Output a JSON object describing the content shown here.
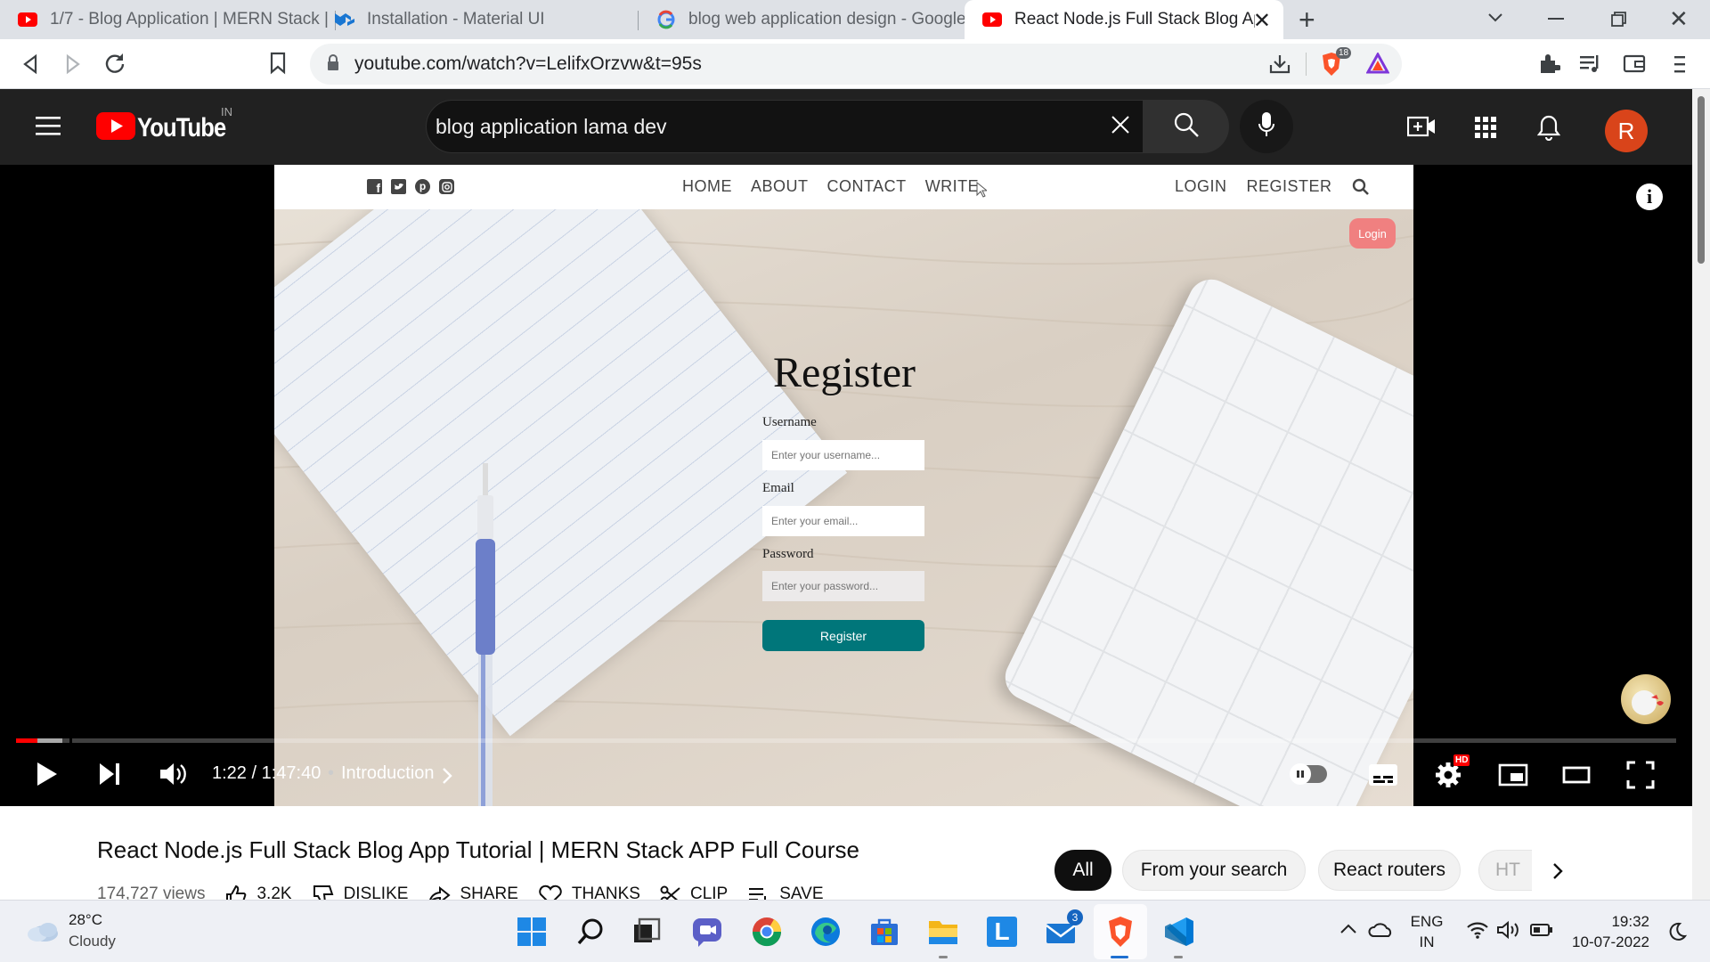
{
  "browser": {
    "tabs": [
      {
        "title": "1/7 - Blog Application | MERN Stack |",
        "favicon": "youtube-icon"
      },
      {
        "title": "Installation - Material UI",
        "favicon": "mui-icon"
      },
      {
        "title": "blog web application design - Google",
        "favicon": "google-icon"
      },
      {
        "title": "React Node.js Full Stack Blog App",
        "favicon": "youtube-icon"
      }
    ],
    "url": "youtube.com/watch?v=LelifxOrzvw&t=95s",
    "brave_badge": "18"
  },
  "youtube": {
    "logo_text": "YouTube",
    "country": "IN",
    "search_value": "blog application lama dev",
    "avatar_letter": "R"
  },
  "video_page": {
    "nav_left": [
      "HOME",
      "ABOUT",
      "CONTACT",
      "WRITE"
    ],
    "nav_right": [
      "LOGIN",
      "REGISTER"
    ],
    "login_button": "Login",
    "title": "Register",
    "labels": {
      "username": "Username",
      "email": "Email",
      "password": "Password"
    },
    "placeholders": {
      "username": "Enter your username...",
      "email": "Enter your email...",
      "password": "Enter your password..."
    },
    "submit": "Register",
    "accent_color": "#00767a",
    "login_color": "#f08080"
  },
  "player": {
    "time": "1:22 / 1:47:40",
    "chapter": "Introduction",
    "progress_fraction": 0.013,
    "hd_badge": "HD"
  },
  "info": {
    "video_title": "React Node.js Full Stack Blog App Tutorial | MERN Stack APP Full Course",
    "views": "174,727 views",
    "likes": "3.2K",
    "actions": [
      "DISLIKE",
      "SHARE",
      "THANKS",
      "CLIP",
      "SAVE"
    ],
    "chips": [
      "All",
      "From your search",
      "React routers",
      "HT"
    ]
  },
  "taskbar": {
    "temp": "28°C",
    "weather": "Cloudy",
    "mail_badge": "3",
    "lang_line1": "ENG",
    "lang_line2": "IN",
    "time": "19:32",
    "date": "10-07-2022"
  }
}
